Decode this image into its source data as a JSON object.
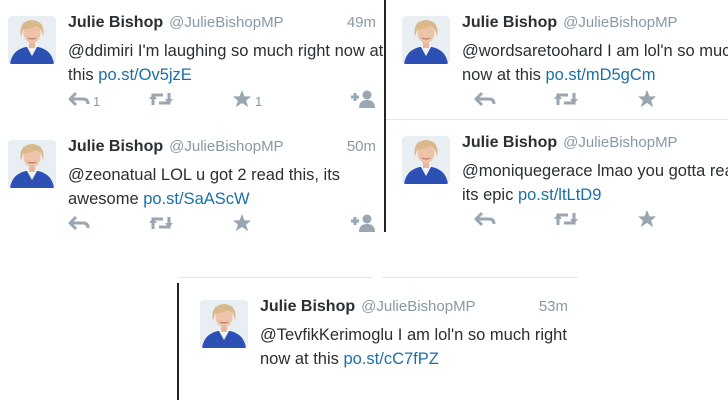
{
  "tweets": [
    {
      "name": "Julie Bishop",
      "handle": "@JulieBishopMP",
      "time": "49m",
      "text": "@ddimiri I'm laughing so much right now at this ",
      "link": "po.st/Ov5jzE",
      "reply_count": "1",
      "favorite_count": "1"
    },
    {
      "name": "Julie Bishop",
      "handle": "@JulieBishopMP",
      "time": "",
      "text": "@wordsaretoohard I am lol'n so much right now at this ",
      "link": "po.st/mD5gCm",
      "reply_count": "",
      "favorite_count": ""
    },
    {
      "name": "Julie Bishop",
      "handle": "@JulieBishopMP",
      "time": "50m",
      "text": "@zeonatual LOL u got 2 read this, its awesome ",
      "link": "po.st/SaAScW",
      "reply_count": "",
      "favorite_count": ""
    },
    {
      "name": "Julie Bishop",
      "handle": "@JulieBishopMP",
      "time": "",
      "text": "@moniquegerace lmao you gotta read this, its epic ",
      "link": "po.st/ltLtD9",
      "reply_count": "",
      "favorite_count": ""
    },
    {
      "name": "Julie Bishop",
      "handle": "@JulieBishopMP",
      "time": "53m",
      "text": "@TevfikKerimoglu I am lol'n so much right now at this ",
      "link": "po.st/cC7fPZ",
      "reply_count": "",
      "favorite_count": ""
    }
  ],
  "icons": {
    "reply": "reply-icon",
    "retweet": "retweet-icon",
    "favorite": "star-icon",
    "follow": "follow-icon"
  },
  "colors": {
    "name": "#292f33",
    "muted": "#8899a6",
    "link": "#1b6fa8",
    "icon": "#9aa7b2",
    "avatar_blue": "#2d50b5"
  }
}
